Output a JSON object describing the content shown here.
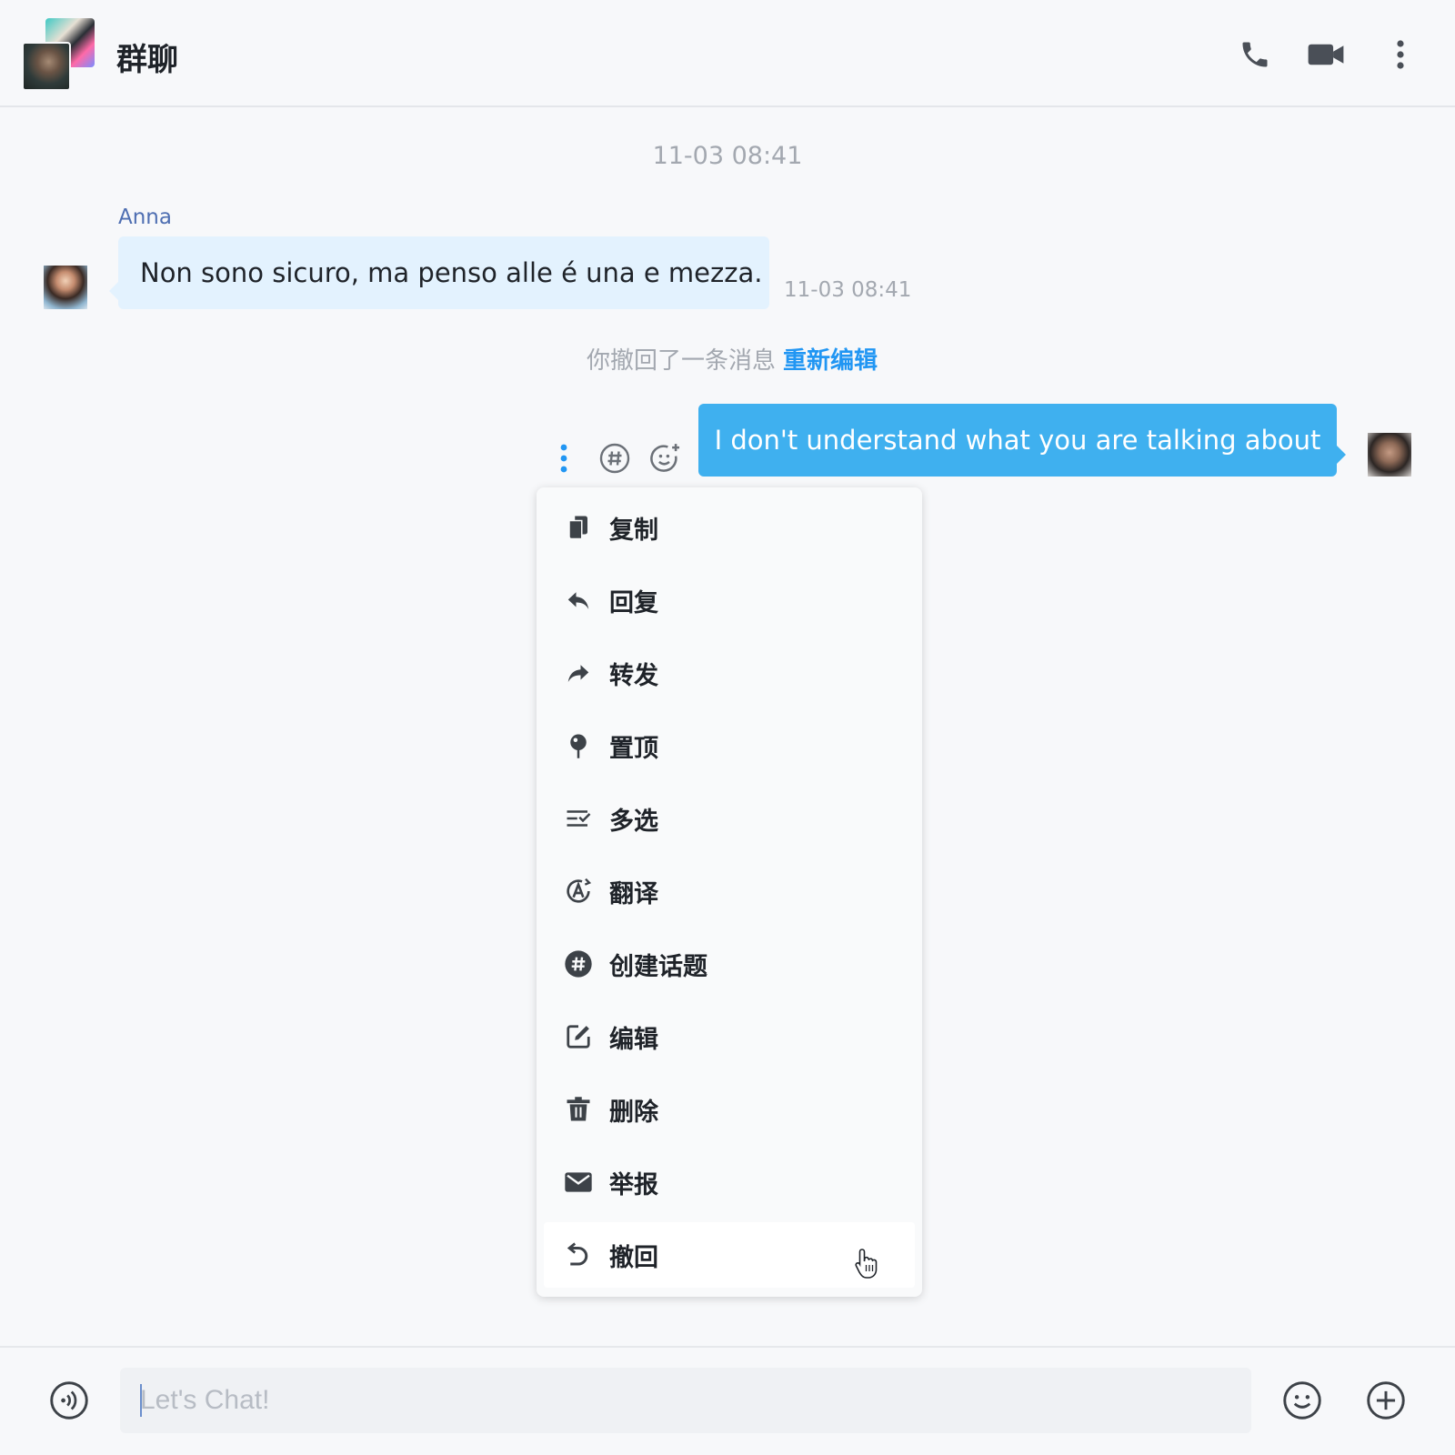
{
  "header": {
    "title": "群聊"
  },
  "messages": {
    "top_timestamp": "11-03 08:41",
    "incoming": {
      "sender": "Anna",
      "text": "Non sono sicuro, ma penso alle é una e mezza.",
      "time": "11-03 08:41"
    },
    "recall_notice": {
      "text": "你撤回了一条消息",
      "action": "重新编辑"
    },
    "outgoing": {
      "text": "I don't understand what you are talking about"
    }
  },
  "context_menu": {
    "items": [
      {
        "label": "复制",
        "icon": "copy-icon"
      },
      {
        "label": "回复",
        "icon": "reply-icon"
      },
      {
        "label": "转发",
        "icon": "forward-icon"
      },
      {
        "label": "置顶",
        "icon": "pin-icon"
      },
      {
        "label": "多选",
        "icon": "multi-select-icon"
      },
      {
        "label": "翻译",
        "icon": "translate-icon"
      },
      {
        "label": "创建话题",
        "icon": "topic-icon"
      },
      {
        "label": "编辑",
        "icon": "edit-icon"
      },
      {
        "label": "删除",
        "icon": "delete-icon"
      },
      {
        "label": "举报",
        "icon": "report-icon"
      },
      {
        "label": "撤回",
        "icon": "recall-icon"
      }
    ],
    "hovered_item": "撤回"
  },
  "composer": {
    "placeholder": "Let's Chat!"
  },
  "colors": {
    "accent": "#2196f3",
    "outgoing_bubble": "#3fb0ef",
    "incoming_bubble": "#e3f2fe",
    "sender_name": "#4f6fb2"
  }
}
